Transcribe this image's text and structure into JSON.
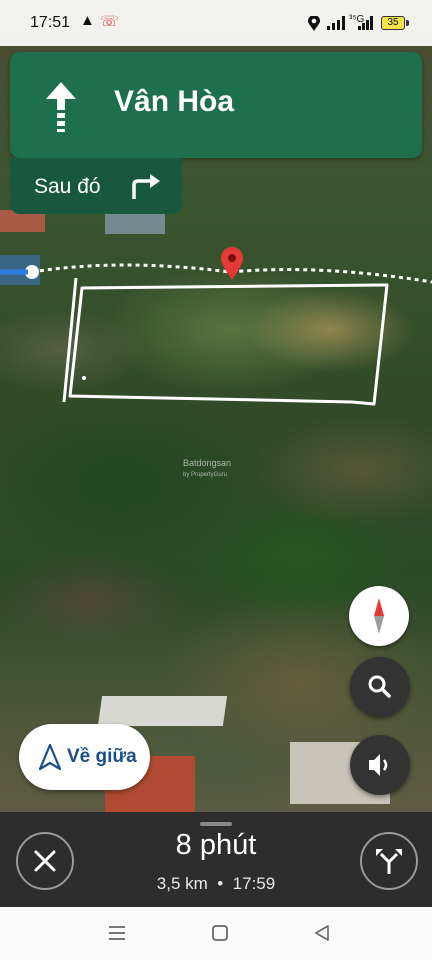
{
  "status_bar": {
    "time": "17:51",
    "network_label": "³⁵G",
    "battery": "35",
    "icons": [
      "navigation-arrow-icon",
      "missed-call-icon",
      "location-icon",
      "signal-icon",
      "signal-icon",
      "battery-icon"
    ]
  },
  "navigation": {
    "direction_icon": "straight-arrow-icon",
    "street": "Vân Hòa",
    "then_label": "Sau đó",
    "then_icon": "turn-right-icon"
  },
  "map": {
    "watermark": "Batdongsan",
    "watermark_sub": "by PropertyGuru",
    "pin_color": "#e53935",
    "route_color": "#ffffff"
  },
  "controls": {
    "compass_icon": "compass-icon",
    "search_icon": "search-icon",
    "sound_icon": "sound-icon",
    "recenter_label": "Về giữa",
    "recenter_icon": "navigation-arrow-icon"
  },
  "trip": {
    "eta": "8 phút",
    "distance": "3,5 km",
    "separator": "•",
    "arrival": "17:59",
    "close_icon": "close-icon",
    "routes_icon": "alternate-routes-icon"
  },
  "system_nav": {
    "icons": [
      "menu-icon",
      "home-icon",
      "back-icon"
    ]
  },
  "colors": {
    "nav_green": "#1e6f4e",
    "nav_dark_green": "#17583e",
    "recenter_blue": "#1a4f8a",
    "bottom_bar": "#2d2d2d"
  }
}
